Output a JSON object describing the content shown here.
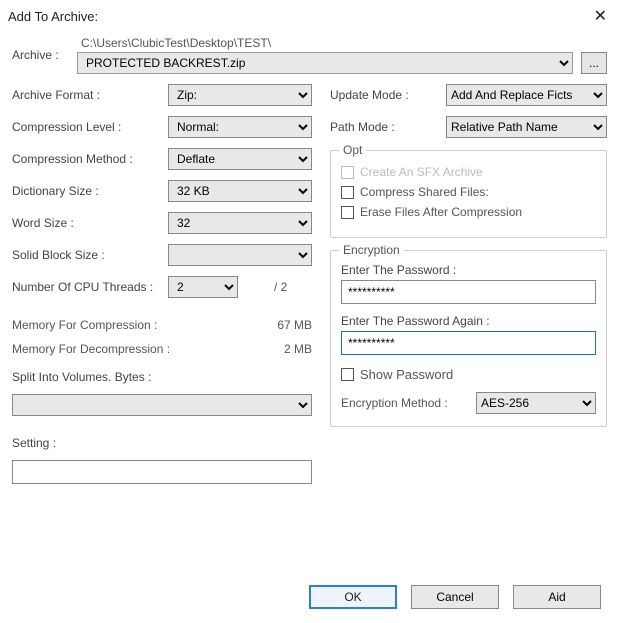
{
  "title": "Add To Archive:",
  "archive": {
    "label": "Archive :",
    "path": "C:\\Users\\ClubicTest\\Desktop\\TEST\\",
    "filename": "PROTECTED BACKREST.zip",
    "browse": "..."
  },
  "left": {
    "format_label": "Archive Format :",
    "format_value": "Zip:",
    "level_label": "Compression Level :",
    "level_value": "Normal:",
    "method_label": "Compression Method :",
    "method_value": "Deflate",
    "dict_label": "Dictionary Size :",
    "dict_value": "32 KB",
    "word_label": "Word Size :",
    "word_value": "32",
    "block_label": "Solid Block Size :",
    "block_value": "",
    "cpu_label": "Number Of CPU Threads :",
    "cpu_value": "2",
    "cpu_max": "/ 2",
    "mem_comp_label": "Memory For Compression :",
    "mem_comp_value": "67 MB",
    "mem_decomp_label": "Memory For Decompression :",
    "mem_decomp_value": "2 MB",
    "split_label": "Split Into Volumes. Bytes :",
    "split_value": "",
    "setting_label": "Setting :",
    "setting_value": ""
  },
  "right": {
    "update_label": "Update Mode :",
    "update_value": "Add And Replace Ficts",
    "path_label": "Path Mode :",
    "path_value": "Relative Path Name",
    "opt": {
      "legend": "Opt",
      "sfx": "Create An SFX Archive",
      "shared": "Compress Shared Files:",
      "erase": "Erase Files After Compression"
    },
    "enc": {
      "legend": "Encryption",
      "pw1_label": "Enter The Password :",
      "pw1_value": "**********",
      "pw2_label": "Enter The Password Again :",
      "pw2_value": "**********",
      "show": "Show Password",
      "method_label": "Encryption Method :",
      "method_value": "AES-256"
    }
  },
  "buttons": {
    "ok": "OK",
    "cancel": "Cancel",
    "aid": "Aid"
  }
}
